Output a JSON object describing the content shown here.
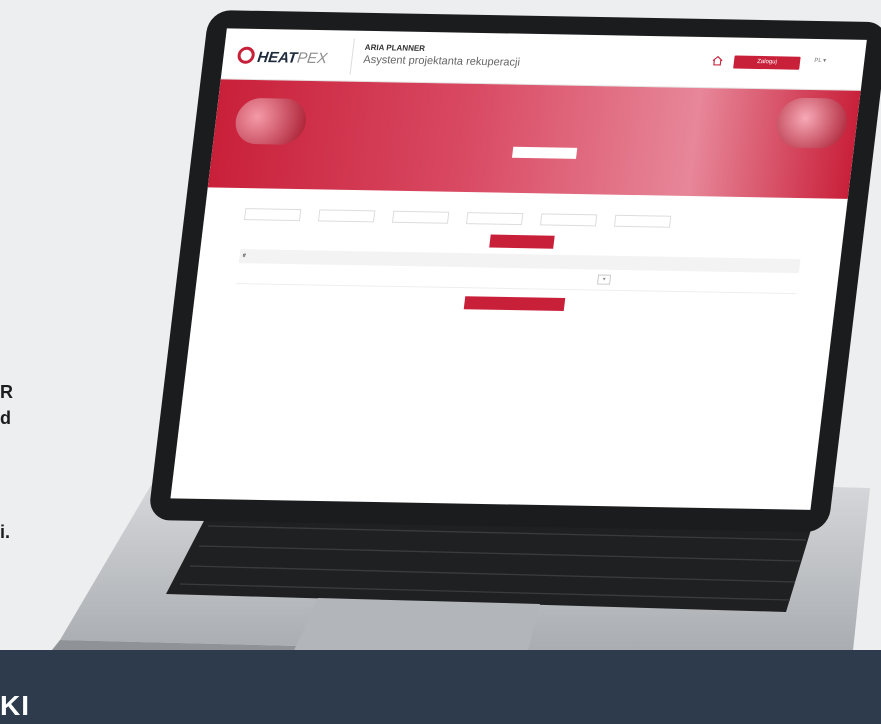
{
  "side_text": {
    "line1": "R",
    "line2": "d",
    "line3": "i."
  },
  "bottom_text": "KI",
  "app": {
    "logo_main": "HEAT",
    "logo_light": "PEX",
    "name": "ARIA PLANNER",
    "subtitle": "Asystent projektanta rekuperacji",
    "login_label": "Zaloguj",
    "lang_label": "PL"
  },
  "hero": {
    "description": "",
    "question_label": "",
    "input_value": "",
    "note": ""
  },
  "form": {
    "section_title": "",
    "field_labels": [],
    "add_button": ""
  },
  "results": {
    "description": "",
    "columns": [
      "#"
    ],
    "rows": [],
    "footnote": "",
    "project_button": ""
  },
  "colors": {
    "accent": "#c9203a",
    "navy": "#2e3b4d"
  }
}
